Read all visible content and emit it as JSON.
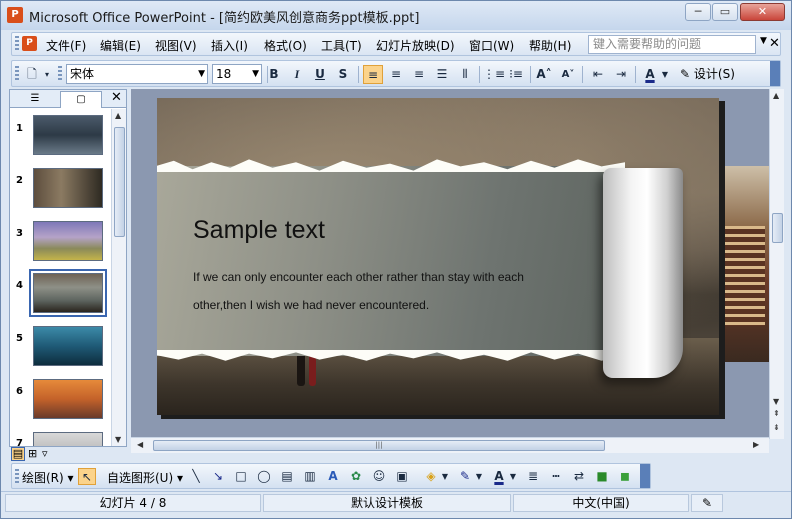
{
  "window": {
    "title": "Microsoft Office PowerPoint - [简约欧美风创意商务ppt模板.ppt]",
    "minimize": "─",
    "restore": "▭",
    "close": "✕"
  },
  "menu": {
    "items": [
      "文件(F)",
      "编辑(E)",
      "视图(V)",
      "插入(I)",
      "格式(O)",
      "工具(T)",
      "幻灯片放映(D)",
      "窗口(W)",
      "帮助(H)"
    ],
    "help_placeholder": "键入需要帮助的问题"
  },
  "format_toolbar": {
    "font_name": "宋体",
    "font_size": "18",
    "bold": "B",
    "italic": "I",
    "underline": "U",
    "shadow": "S",
    "design_label": "设计(S)"
  },
  "outline_pane": {
    "thumbnails": [
      {
        "number": "1"
      },
      {
        "number": "2"
      },
      {
        "number": "3"
      },
      {
        "number": "4"
      },
      {
        "number": "5"
      },
      {
        "number": "6"
      },
      {
        "number": "7"
      }
    ],
    "selected_index": 4
  },
  "slide": {
    "heading": "Sample text",
    "body": "If we can only encounter each other rather than stay with each other,then I wish we had never encountered."
  },
  "draw_toolbar": {
    "draw_label": "绘图(R)",
    "autoshapes_label": "自选图形(U)"
  },
  "status": {
    "slide_counter": "幻灯片 4 / 8",
    "template": "默认设计模板",
    "language": "中文(中国)"
  },
  "colors": {
    "accent": "#3a66b0",
    "active_button": "#fbd38b"
  }
}
